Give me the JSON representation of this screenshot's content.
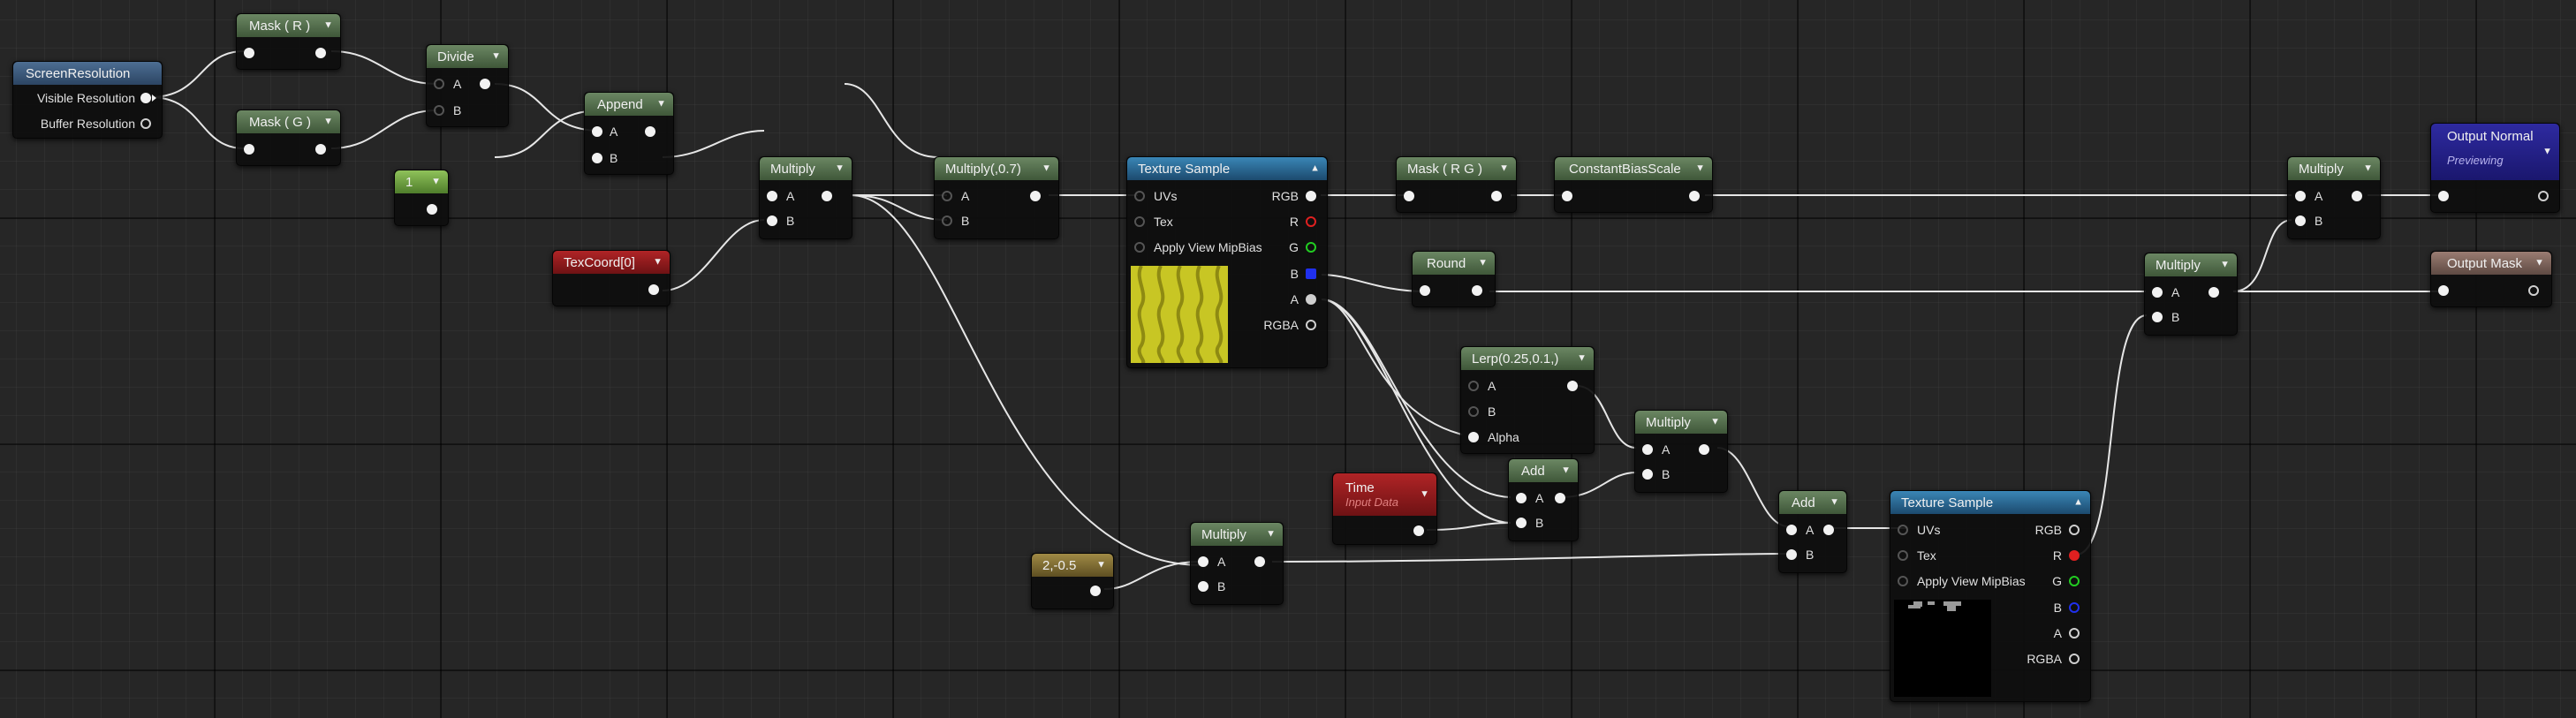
{
  "nodes": {
    "screen_resolution": {
      "title": "ScreenResolution",
      "pins": [
        "Visible Resolution",
        "Buffer Resolution"
      ]
    },
    "mask_r": {
      "title": "Mask ( R )"
    },
    "mask_g": {
      "title": "Mask ( G )"
    },
    "divide": {
      "title": "Divide",
      "pins": [
        "A",
        "B"
      ]
    },
    "append": {
      "title": "Append",
      "pins": [
        "A",
        "B"
      ]
    },
    "const_1": {
      "title": "1"
    },
    "texcoord": {
      "title": "TexCoord[0]"
    },
    "multiply_1": {
      "title": "Multiply",
      "pins": [
        "A",
        "B"
      ]
    },
    "multiply_07": {
      "title": "Multiply(,0.7)",
      "pins": [
        "A",
        "B"
      ]
    },
    "texture_sample_1": {
      "title": "Texture Sample",
      "inputs": [
        "UVs",
        "Tex",
        "Apply View MipBias"
      ],
      "outputs": [
        "RGB",
        "R",
        "G",
        "B",
        "A",
        "RGBA"
      ]
    },
    "mask_rg": {
      "title": "Mask ( R G )"
    },
    "constant_bias_scale": {
      "title": "ConstantBiasScale"
    },
    "round": {
      "title": "Round"
    },
    "lerp": {
      "title": "Lerp(0.25,0.1,)",
      "pins": [
        "A",
        "B",
        "Alpha"
      ]
    },
    "multiply_2": {
      "title": "Multiply",
      "pins": [
        "A",
        "B"
      ]
    },
    "time": {
      "title": "Time",
      "subtitle": "Input Data"
    },
    "add_1": {
      "title": "Add",
      "pins": [
        "A",
        "B"
      ]
    },
    "const_2": {
      "title": "2,-0.5"
    },
    "multiply_3": {
      "title": "Multiply",
      "pins": [
        "A",
        "B"
      ]
    },
    "add_2": {
      "title": "Add",
      "pins": [
        "A",
        "B"
      ]
    },
    "texture_sample_2": {
      "title": "Texture Sample",
      "inputs": [
        "UVs",
        "Tex",
        "Apply View MipBias"
      ],
      "outputs": [
        "RGB",
        "R",
        "G",
        "B",
        "A",
        "RGBA"
      ]
    },
    "multiply_4": {
      "title": "Multiply",
      "pins": [
        "A",
        "B"
      ]
    },
    "multiply_5": {
      "title": "Multiply",
      "pins": [
        "A",
        "B"
      ]
    },
    "output_normal": {
      "title": "Output Normal",
      "subtitle": "Previewing"
    },
    "output_mask": {
      "title": "Output Mask"
    }
  },
  "colors": {
    "pin_r": "#e02020",
    "pin_g": "#22cc22",
    "pin_b": "#2030ee",
    "texture_preview_1": "#c8c624",
    "texture_preview_2": "#000000"
  },
  "icons": {
    "collapse": "chevron-down-icon",
    "expand": "chevron-up-icon"
  }
}
